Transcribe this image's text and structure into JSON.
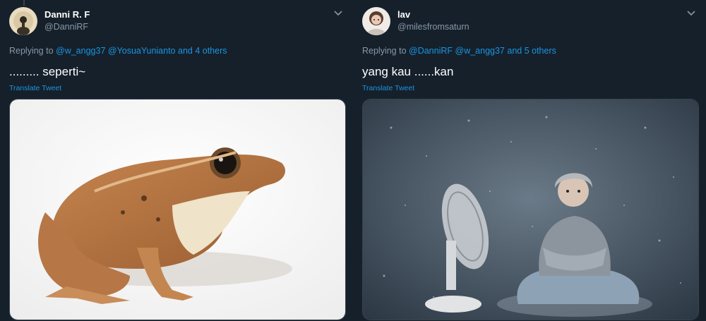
{
  "tweets": [
    {
      "name": "Danni R. F",
      "handle": "@DanniRF",
      "replying_prefix": "Replying to ",
      "replying_mentions": "@w_angg37 @YosuaYunianto",
      "replying_suffix": " and 4 others",
      "text": "......... seperti~",
      "translate": "Translate Tweet",
      "avatar_icon": "avatar-photo",
      "menu_icon": "chevron-down-icon"
    },
    {
      "name": "lav",
      "handle": "@milesfromsaturn",
      "replying_prefix": "Replying to ",
      "replying_mentions": "@DanniRF @w_angg37",
      "replying_suffix": " and 5 others",
      "text": "yang kau ......kan",
      "translate": "Translate Tweet",
      "avatar_icon": "avatar-photo",
      "menu_icon": "chevron-down-icon"
    }
  ],
  "colors": {
    "background": "#15202b",
    "secondary_text": "#8899a6",
    "link": "#1b95e0"
  }
}
